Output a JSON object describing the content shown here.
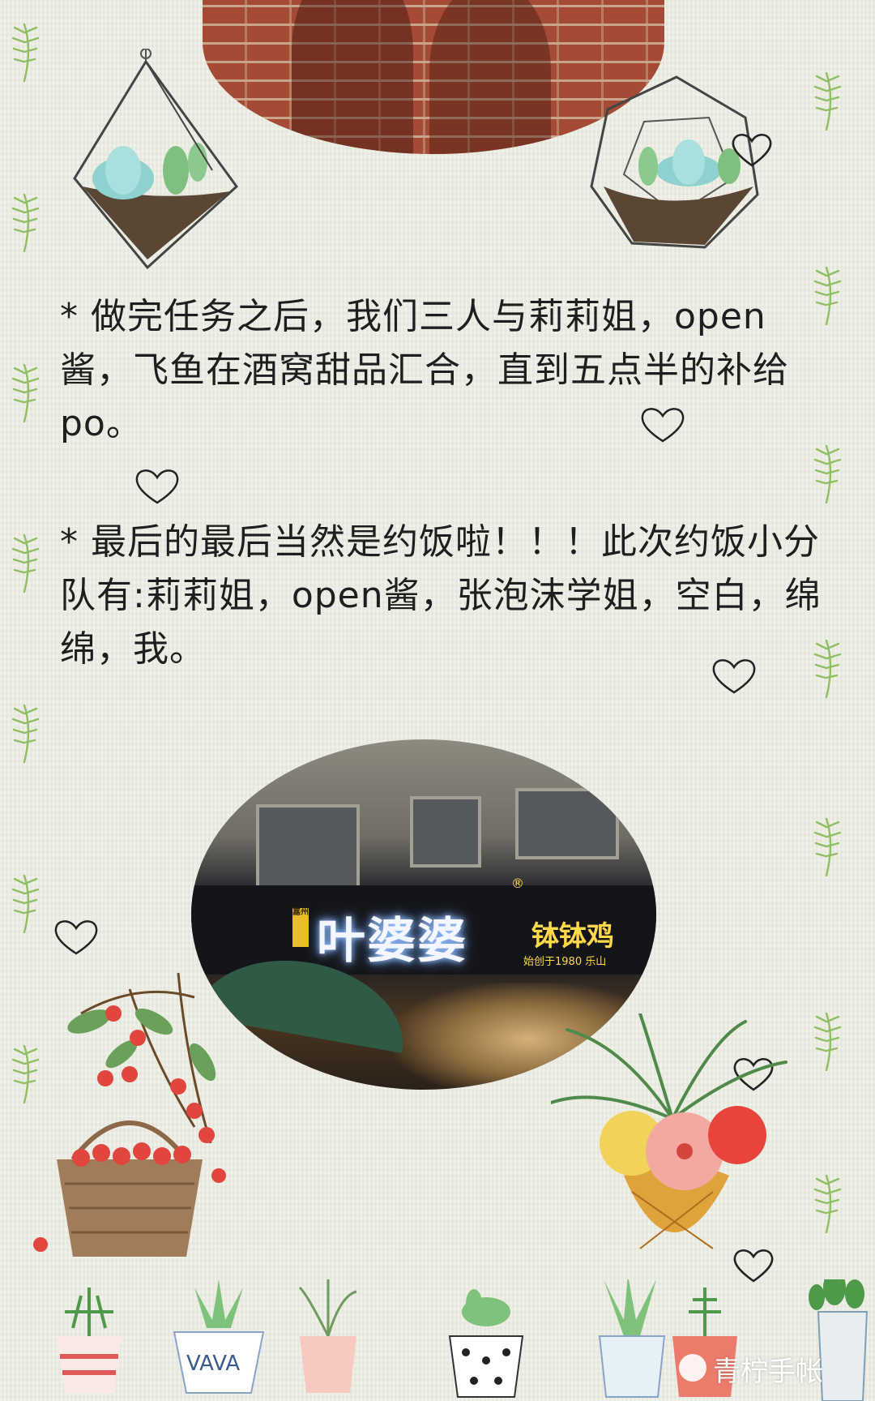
{
  "paragraphs": [
    "* 做完任务之后，我们三人与莉莉姐，open酱，飞鱼在酒窝甜品汇合，直到五点半的补给po。",
    "* 最后的最后当然是约饭啦！！！此次约饭小分队有:莉莉姐，open酱，张泡沫学姐，空白，绵绵，我。"
  ],
  "photos": {
    "top": {
      "subject": "brick-wall-shadow-photo"
    },
    "shop": {
      "sign_main": "叶婆婆",
      "sign_tag": "嘉州",
      "sign_side": "钵钵鸡",
      "sign_small": "始创于1980 乐山",
      "sign_reg": "®"
    }
  },
  "decorations": {
    "icons": [
      "terrarium-icon",
      "succulent-icon",
      "heart-icon",
      "fern-icon",
      "cherry-basket-icon",
      "pineapple-bouquet-icon",
      "potted-plant-icon"
    ],
    "pot_label": "VAVA"
  },
  "watermark": {
    "text": "青柠手帐"
  },
  "colors": {
    "paper": "#ecede3",
    "text": "#1e1e1e",
    "fern": "#8fbf62",
    "heart_stroke": "#222222"
  }
}
